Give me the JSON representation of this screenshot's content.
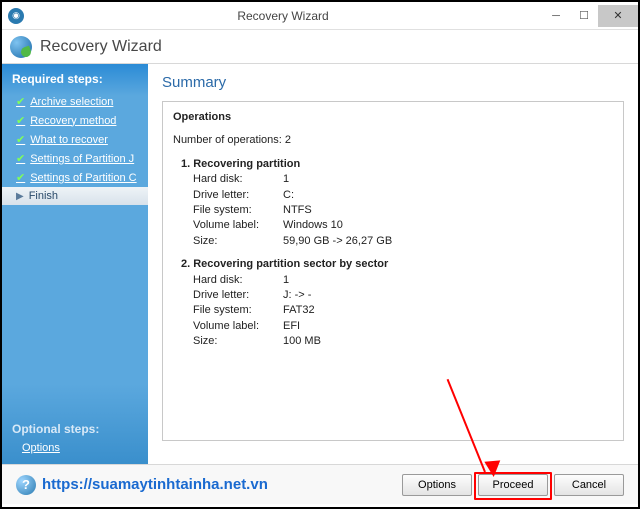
{
  "window": {
    "title": "Recovery Wizard"
  },
  "header": {
    "title": "Recovery Wizard"
  },
  "sidebar": {
    "required_label": "Required steps:",
    "items": [
      {
        "label": "Archive selection"
      },
      {
        "label": "Recovery method"
      },
      {
        "label": "What to recover"
      },
      {
        "label": "Settings of Partition J"
      },
      {
        "label": "Settings of Partition C"
      }
    ],
    "active": {
      "label": "Finish"
    },
    "optional_label": "Optional steps:",
    "options_link": "Options"
  },
  "main": {
    "heading": "Summary",
    "operations_label": "Operations",
    "count_label": "Number of operations: 2",
    "op1": {
      "title": "1. Recovering partition",
      "hard_disk_k": "Hard disk:",
      "hard_disk_v": "1",
      "drive_k": "Drive letter:",
      "drive_v": "C:",
      "fs_k": "File system:",
      "fs_v": "NTFS",
      "vol_k": "Volume label:",
      "vol_v": "Windows 10",
      "size_k": "Size:",
      "size_v": "59,90 GB -> 26,27 GB"
    },
    "op2": {
      "title": "2. Recovering partition sector by sector",
      "hard_disk_k": "Hard disk:",
      "hard_disk_v": "1",
      "drive_k": "Drive letter:",
      "drive_v": "J: -> -",
      "fs_k": "File system:",
      "fs_v": "FAT32",
      "vol_k": "Volume label:",
      "vol_v": "EFI",
      "size_k": "Size:",
      "size_v": "100 MB"
    }
  },
  "footer": {
    "url": "https://suamaytinhtainha.net.vn",
    "options": "Options",
    "proceed": "Proceed",
    "cancel": "Cancel"
  }
}
